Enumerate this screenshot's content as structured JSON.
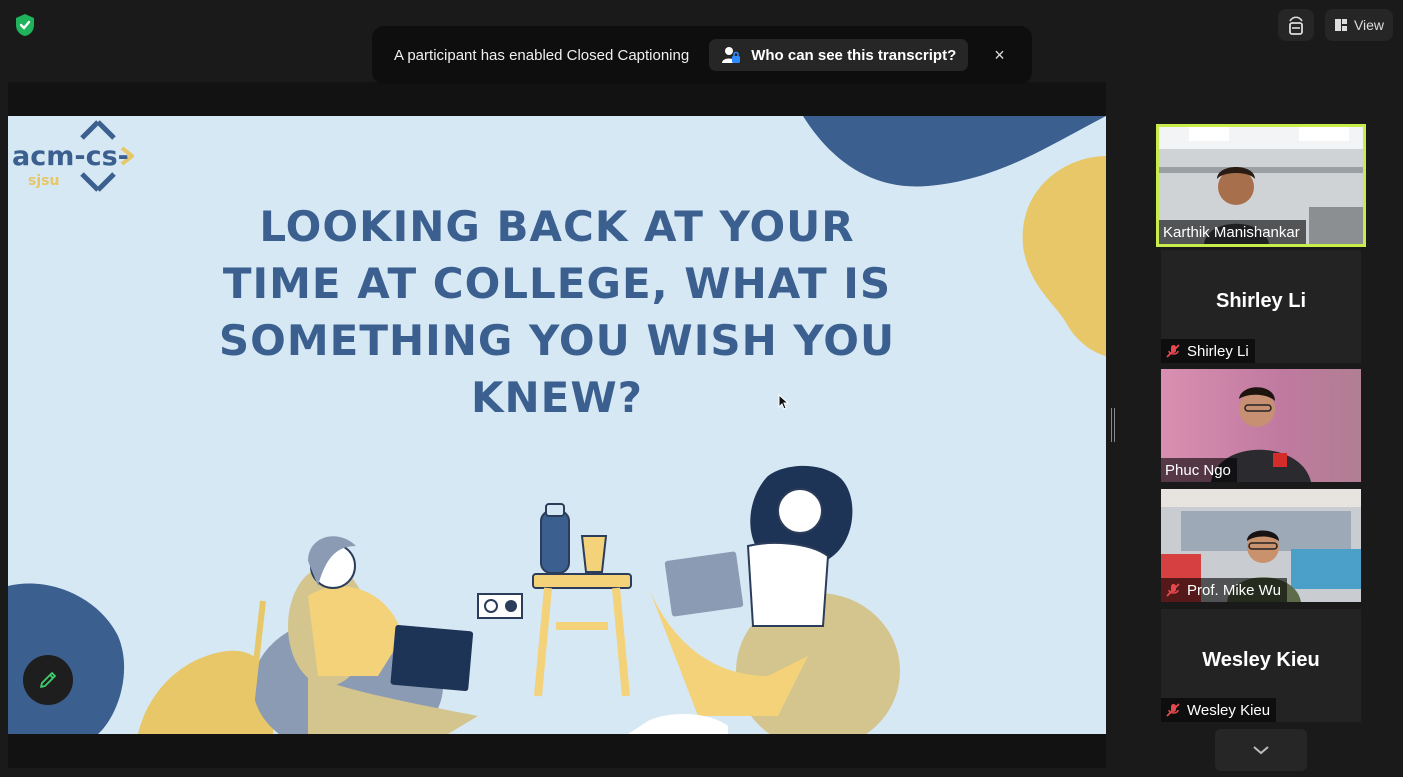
{
  "header": {
    "view_label": "View"
  },
  "caption_banner": {
    "message": "A participant has enabled Closed Captioning",
    "button_label": "Who can see this transcript?",
    "close_symbol": "×"
  },
  "slide": {
    "logo_text": "acm-cs-",
    "logo_sub": "sjsu",
    "title_lines": [
      "LOOKING BACK AT YOUR",
      "TIME AT COLLEGE, WHAT IS",
      "SOMETHING YOU WISH YOU",
      "KNEW?"
    ]
  },
  "participants": [
    {
      "name": "Karthik Manishankar",
      "muted": false,
      "video": true,
      "speaking": true
    },
    {
      "name": "Shirley Li",
      "muted": true,
      "video": false
    },
    {
      "name": "Phuc Ngo",
      "muted": false,
      "video": true
    },
    {
      "name": "Prof. Mike Wu",
      "muted": true,
      "video": true
    },
    {
      "name": "Wesley Kieu",
      "muted": true,
      "video": false
    }
  ],
  "colors": {
    "accent_speaking": "#c7ec4b",
    "mute_red": "#e5484d",
    "slide_bg": "#d6e8f4",
    "slide_title": "#3b5f8f",
    "slide_accent_yellow": "#e7c767"
  },
  "icons": [
    "shield-check-icon",
    "captions-icon",
    "view-layout-icon",
    "person-lock-icon",
    "close-icon",
    "pencil-icon",
    "chevron-down-icon",
    "mic-muted-icon"
  ]
}
